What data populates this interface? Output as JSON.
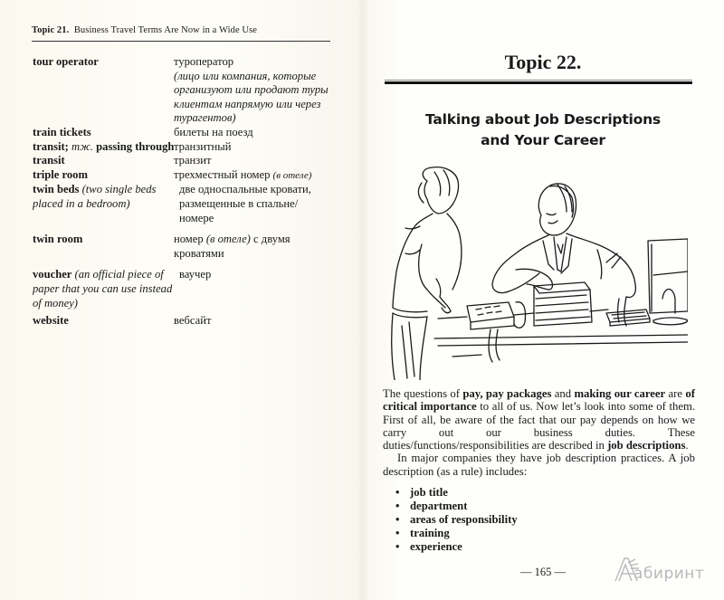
{
  "left_page": {
    "running_head": {
      "topic_label": "Topic 21.",
      "title": "Business Travel Terms Are Now in a Wide Use"
    },
    "vocabulary": [
      {
        "term": "tour operator",
        "note": "",
        "translation": "туроператор",
        "translation_note": "(лицо или компания, которые организуют или продают туры клиентам напрямую или через турагентов)"
      },
      {
        "term": "train tickets",
        "note": "",
        "translation": "билеты на поезд",
        "translation_note": ""
      },
      {
        "term": "transit;",
        "abbr": "тж.",
        "term2": "passing through",
        "translation": "транзитный",
        "translation_note": ""
      },
      {
        "term": "transit",
        "note": "",
        "translation": "транзит",
        "translation_note": ""
      },
      {
        "term": "triple room",
        "note": "",
        "translation": "трехместный номер",
        "translation_note": "(в отеле)"
      },
      {
        "term": "twin beds",
        "note": "(two single beds placed in a bedroom)",
        "translation": "две односпальные кровати, размещенные в спальне/номере",
        "translation_note": ""
      },
      {
        "term": "twin room",
        "note": "",
        "translation_pre": "номер",
        "translation_note": "(в отеле)",
        "translation_post": "с двумя кроватями"
      },
      {
        "term": "voucher",
        "note": "(an official piece of paper that you can use instead of money)",
        "translation": "ваучер",
        "translation_note": ""
      },
      {
        "term": "website",
        "note": "",
        "translation": "вебсайт",
        "translation_note": ""
      }
    ]
  },
  "right_page": {
    "topic_title": "Topic 22.",
    "subtitle_line1": "Talking about Job Descriptions",
    "subtitle_line2": "and Your Career",
    "illustration": {
      "description": "Line drawing: a woman standing beside a desk while a man in a suit seated at the desk points at a stack of papers; a desk phone, keyboard and computer monitor are on the desk."
    },
    "paragraph1": {
      "t1": "The questions of ",
      "b1": "pay, pay packages",
      "t2": " and ",
      "b2": "making our career",
      "t3": " are ",
      "b3": "of critical importance",
      "t4": " to all of us. Now let’s look into some of them. First of all, be aware of the fact that our pay depends on how we carry out our business duties. These duties/functions/responsibilities are described in ",
      "b4": "job descriptions",
      "t5": "."
    },
    "paragraph2": "In major companies they have job description practices. A job description (as a rule) includes:",
    "bullet_symbol": "•",
    "bullets": [
      "job title",
      "department",
      "areas of responsibility",
      "training",
      "experience"
    ],
    "page_number": "— 165 —"
  },
  "watermark": {
    "text": "абиринт",
    "color": "#b9b9b9"
  }
}
